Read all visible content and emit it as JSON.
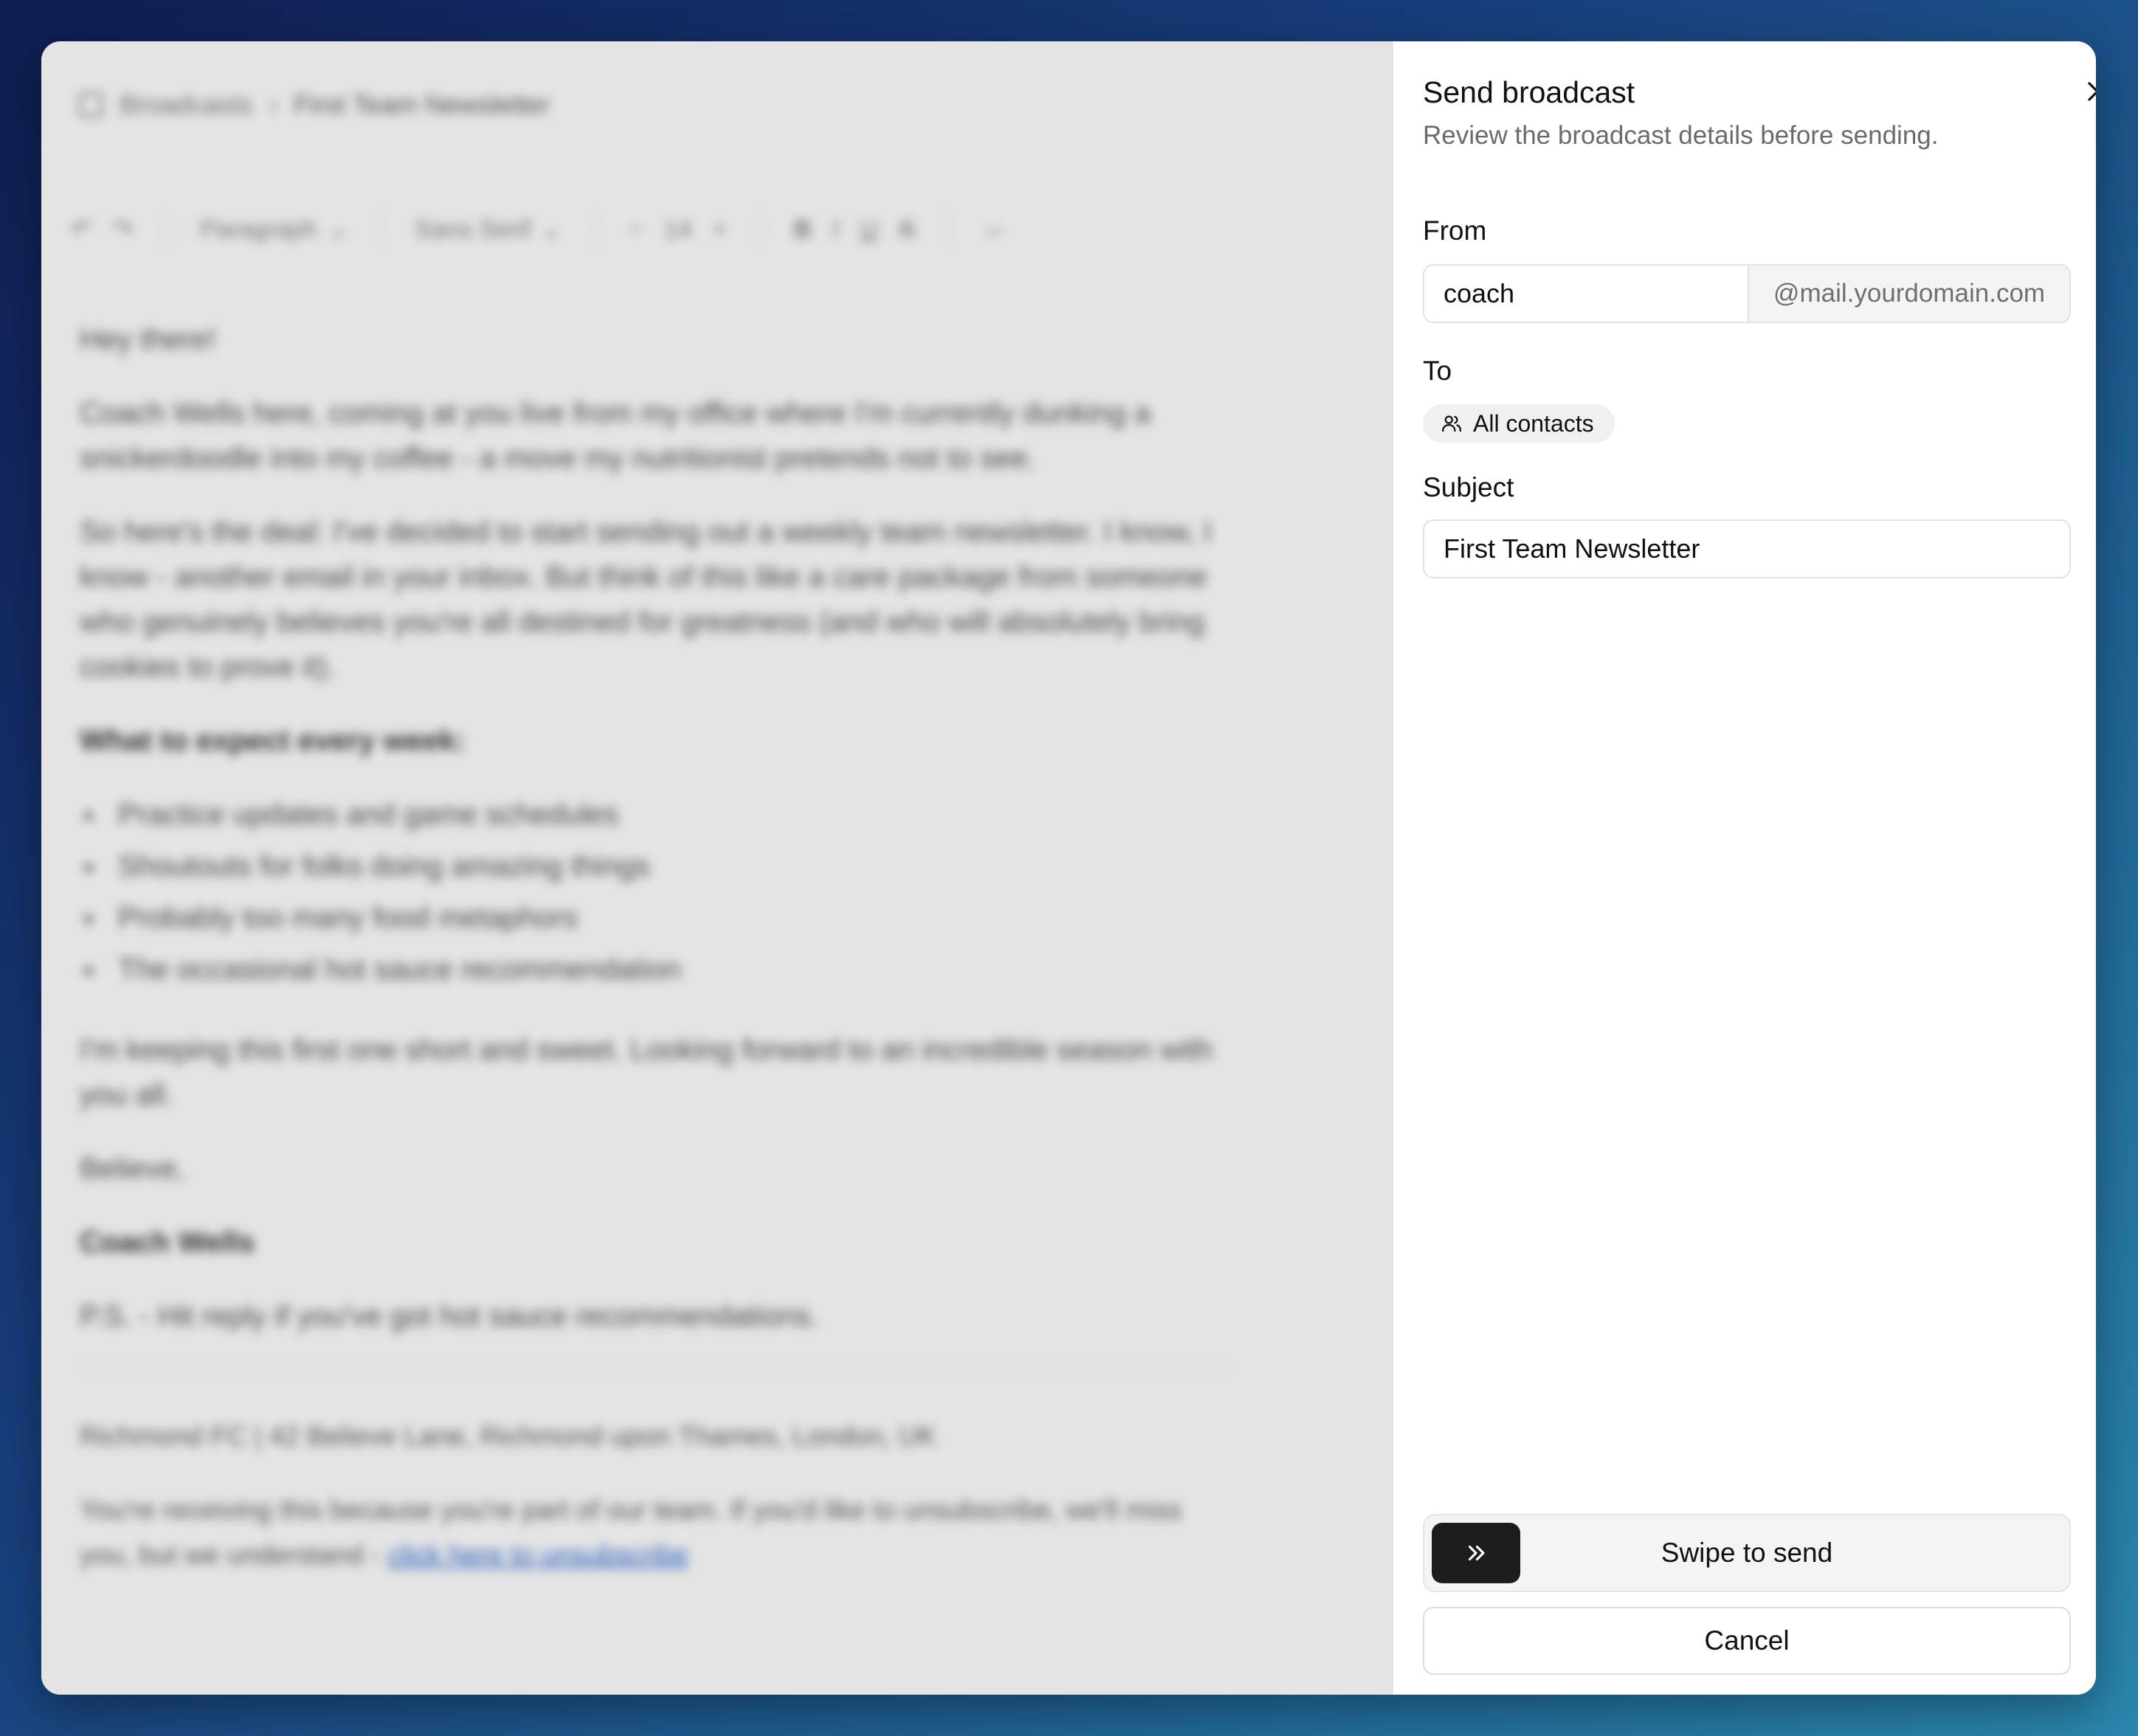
{
  "editor": {
    "breadcrumb": {
      "root": "Broadcasts",
      "separator": "›",
      "current": "First Team Newsletter"
    },
    "toolbar": {
      "undo": "↶",
      "redo": "↷",
      "block_type": "Paragraph",
      "font_family": "Sans Serif",
      "font_decrease": "−",
      "font_size": "14",
      "font_increase": "+",
      "bold": "B",
      "italic": "I",
      "underline": "U",
      "strike": "S",
      "link": "⇔"
    },
    "body": {
      "greeting": "Hey there!",
      "para1": "Coach Wells here, coming at you live from my office where I'm currently dunking a snickerdoodle into my coffee - a move my nutritionist pretends not to see.",
      "para2": "So here's the deal: I've decided to start sending out a weekly team newsletter. I know, I know - another email in your inbox. But think of this like a care package from someone who genuinely believes you're all destined for greatness (and who will absolutely bring cookies to prove it).",
      "heading": "What to expect every week:",
      "bullets": [
        "Practice updates and game schedules",
        "Shoutouts for folks doing amazing things",
        "Probably too many food metaphors",
        "The occasional hot sauce recommendation"
      ],
      "para3": "I'm keeping this first one short and sweet. Looking forward to an incredible season with you all.",
      "signoff": "Believe,",
      "signature": "Coach Wells",
      "ps": "P.S. - Hit reply if you've got hot sauce recommendations.",
      "footer_address": "Richmond FC | 42 Believe Lane, Richmond upon Thames, London, UK",
      "footer_notice": "You're receiving this because you're part of our team. If you'd like to unsubscribe, we'll miss you, but we understand - ",
      "footer_link": "click here to unsubscribe"
    }
  },
  "panel": {
    "title": "Send broadcast",
    "subtitle": "Review the broadcast details before sending.",
    "close_icon": "close-icon",
    "from": {
      "label": "From",
      "value": "coach",
      "suffix": "@mail.yourdomain.com"
    },
    "to": {
      "label": "To",
      "chip": "All contacts",
      "chip_icon": "users-icon"
    },
    "subject": {
      "label": "Subject",
      "value": "First Team Newsletter"
    },
    "swipe": {
      "label": "Swipe to send",
      "handle_icon": "chevrons-right-icon"
    },
    "cancel": "Cancel"
  },
  "colors": {
    "background_gradient": [
      "#0f1c4f",
      "#2a86ae"
    ],
    "swipe_handle": "#1d1d1d",
    "panel_bg": "#ffffff"
  }
}
